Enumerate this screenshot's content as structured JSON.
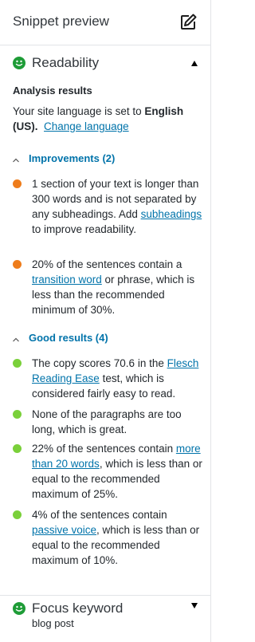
{
  "snippet": {
    "title": "Snippet preview",
    "icon": "edit-icon"
  },
  "readability": {
    "title": "Readability",
    "status_color": "#1e9c37"
  },
  "analysis": {
    "heading": "Analysis results",
    "lang_prefix": "Your site language is set to ",
    "lang_value": "English (US).",
    "change_link": "Change language"
  },
  "improvements": {
    "label": "Improvements (2)",
    "items": [
      {
        "pre": "1 section of your text is longer than 300 words and is not separated by any subheadings. Add ",
        "link": "subheadings",
        "post": " to improve readability.",
        "color": "#ee7c1b"
      },
      {
        "pre": "20% of the sentences contain a ",
        "link": "transition word",
        "post": " or phrase, which is less than the recommended minimum of 30%.",
        "color": "#ee7c1b"
      }
    ]
  },
  "good": {
    "label": "Good results (4)",
    "items": [
      {
        "pre": "The copy scores 70.6 in the ",
        "link": "Flesch Reading Ease",
        "post": " test, which is considered fairly easy to read.",
        "color": "#7ad03a"
      },
      {
        "pre": "None of the paragraphs are too long, which is great.",
        "link": "",
        "post": "",
        "color": "#7ad03a"
      },
      {
        "pre": "22% of the sentences contain ",
        "link": "more than 20 words",
        "post": ", which is less than or equal to the recommended maximum of 25%.",
        "color": "#7ad03a"
      },
      {
        "pre": "4% of the sentences contain ",
        "link": "passive voice",
        "post": ", which is less than or equal to the recommended maximum of 10%.",
        "color": "#7ad03a"
      }
    ]
  },
  "focus": {
    "title": "Focus keyword",
    "keyword": "blog post"
  }
}
